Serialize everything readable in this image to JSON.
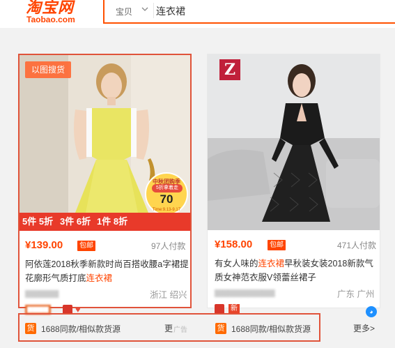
{
  "header": {
    "logo_cn": "淘宝网",
    "logo_en": "Taobao.com",
    "search_type": "宝贝",
    "search_value": "连衣裙"
  },
  "products": [
    {
      "badge": "以图搜货",
      "promo_items": [
        "5件 5折",
        "3件 6折",
        "1件 8折"
      ],
      "promo_circle": {
        "top": "中秋团购季",
        "pill": "5折拿着走",
        "num": "70",
        "date": "Time:9.13-9.17"
      },
      "price": "¥139.00",
      "post_tag": "包邮",
      "sales": "97人付款",
      "title_before": "阿依莲2018秋季新款时尚百搭收腰a字裙提花廓形气质打底",
      "title_keyword": "连衣裙",
      "title_after": "",
      "location": "浙江 绍兴",
      "source_label": "1688同款/相似款货源",
      "more": "更",
      "ad": "广告"
    },
    {
      "brand_letter": "Z",
      "price": "¥158.00",
      "post_tag": "包邮",
      "sales": "471人付款",
      "title_before": "有女人味的",
      "title_keyword": "连衣裙",
      "title_after": "早秋装女装2018新款气质女神范衣服V领蕾丝裙子",
      "location": "广东 广州",
      "new_badge": "新",
      "source_label": "1688同款/相似款货源",
      "more": "更多>"
    }
  ],
  "source_icon_text": "货",
  "colors": {
    "brand": "#ff4400",
    "accent": "#ff5000",
    "highlight_box": "#e0533a"
  }
}
